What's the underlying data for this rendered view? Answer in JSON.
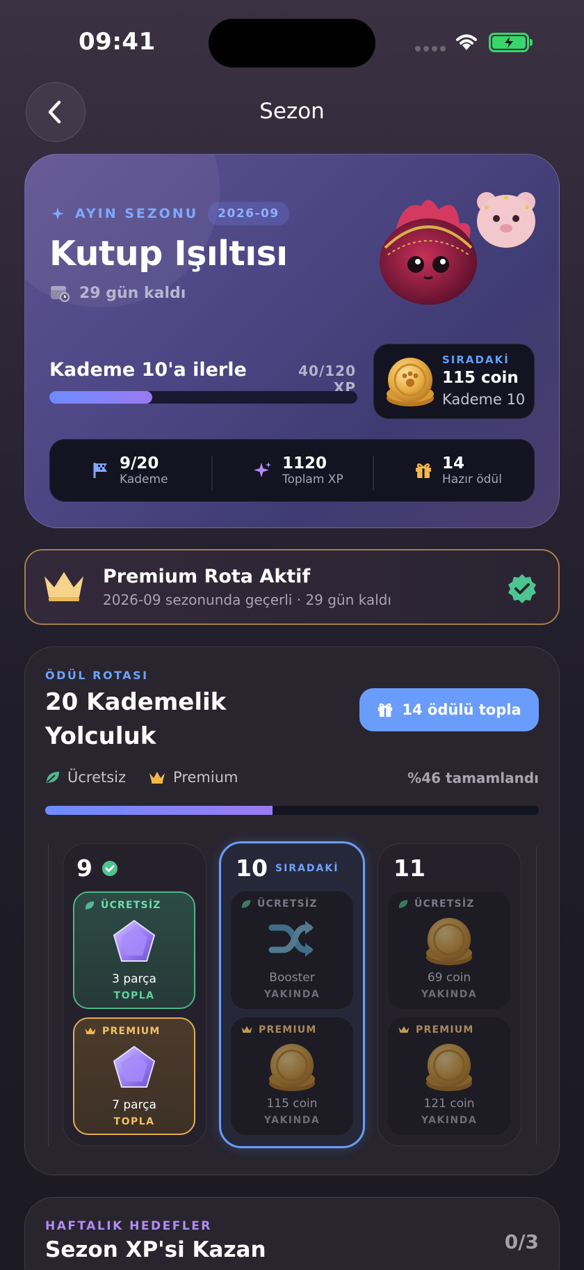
{
  "status_bar": {
    "time": "09:41"
  },
  "header": {
    "title": "Sezon"
  },
  "hero": {
    "season_label": "AYIN SEZONU",
    "season_date": "2026-09",
    "title": "Kutup Işıltısı",
    "days_left": "29 gün kaldı",
    "tier_goal": "Kademe 10'a ilerle",
    "xp_progress_text": "40/120 XP",
    "xp_progress": 0.333,
    "next": {
      "tag": "SIRADAKİ",
      "amount": "115 coin",
      "tier": "Kademe 10"
    },
    "stats": [
      {
        "value": "9/20",
        "label": "Kademe",
        "icon": "flag-icon"
      },
      {
        "value": "1120",
        "label": "Toplam XP",
        "icon": "sparkle-icon"
      },
      {
        "value": "14",
        "label": "Hazır ödül",
        "icon": "gift-icon"
      }
    ]
  },
  "premium": {
    "title": "Premium Rota Aktif",
    "subtitle": "2026-09 sezonunda geçerli · 29 gün kaldı"
  },
  "route": {
    "tag": "ÖDÜL ROTASI",
    "title": "20 Kademelik Yolculuk",
    "collect_button": "14 ödülü topla",
    "legend_free": "Ücretsiz",
    "legend_premium": "Premium",
    "complete_text": "%46 tamamlandı",
    "progress": 0.46,
    "tiers": [
      {
        "number": "9",
        "free": {
          "label": "ÜCRETSİZ",
          "name": "3 parça",
          "action": "TOPLA"
        },
        "premium": {
          "label": "PREMIUM",
          "name": "7 parça",
          "action": "TOPLA"
        }
      },
      {
        "number": "10",
        "tag": "SIRADAKİ",
        "free": {
          "label": "ÜCRETSİZ",
          "name": "Booster",
          "action": "YAKINDA"
        },
        "premium": {
          "label": "PREMIUM",
          "name": "115 coin",
          "action": "YAKINDA"
        }
      },
      {
        "number": "11",
        "free": {
          "label": "ÜCRETSİZ",
          "name": "69 coin",
          "action": "YAKINDA"
        },
        "premium": {
          "label": "PREMIUM",
          "name": "121 coin",
          "action": "YAKINDA"
        }
      }
    ]
  },
  "weekly": {
    "tag": "HAFTALIK HEDEFLER",
    "title": "Sezon XP'si Kazan",
    "count": "0/3"
  },
  "colors": {
    "accent_blue": "#6a9dfb",
    "premium_gold": "#e1ae56",
    "free_green": "#4fb48a",
    "progress_purple": "#9a7af0"
  }
}
